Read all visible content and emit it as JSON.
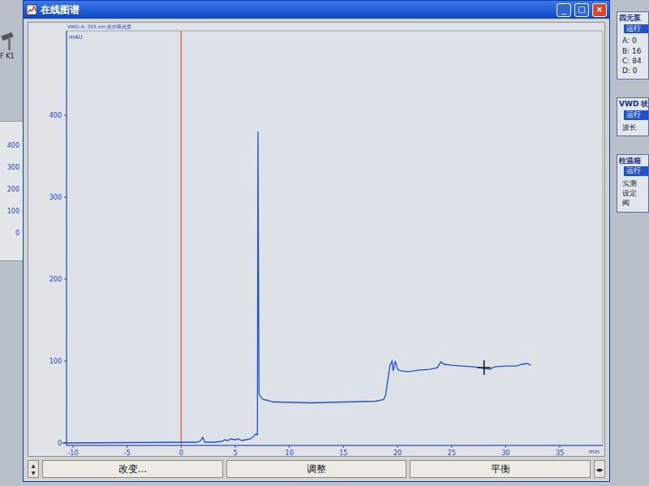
{
  "window": {
    "title": "在线图谱",
    "controls": [
      "_",
      "□",
      "×"
    ]
  },
  "left_panel": {
    "label": "F K1",
    "y_ticks": [
      "400",
      "300",
      "200",
      "100",
      "0"
    ]
  },
  "chart": {
    "title": "VWD A: 355 nm 处的吸光度",
    "y_unit": "mAU",
    "x_unit": "min",
    "y_ticks": [
      "0",
      "100",
      "200",
      "300",
      "400"
    ],
    "x_ticks": [
      "-10",
      "-5",
      "0",
      "5",
      "10",
      "15",
      "20",
      "25",
      "30",
      "35"
    ],
    "marker_x": 0,
    "cursor": {
      "x": 28,
      "y": 92
    },
    "series": [
      {
        "x": [
          -11,
          1.5,
          1.8,
          2,
          2.2,
          3,
          3.8,
          4,
          4.3,
          4.6,
          5,
          5.3,
          5.6,
          6,
          6.4,
          6.7,
          6.9,
          7.05,
          7.1,
          7.2,
          7.4,
          7.6,
          8,
          8.5,
          9,
          12,
          15,
          18,
          18.7,
          18.9,
          19.3,
          19.5,
          19.6,
          19.8,
          20,
          20.3,
          21,
          22,
          23,
          23.7,
          24,
          24.3,
          25,
          26,
          27,
          28,
          28.5,
          29,
          30,
          31,
          31.5,
          32,
          32.3
        ],
        "y": [
          0,
          1,
          3,
          7,
          1,
          1,
          2,
          4,
          3,
          5,
          4,
          5,
          3,
          4,
          5,
          8,
          11,
          10,
          380,
          60,
          55,
          53,
          52,
          50,
          50,
          49,
          50,
          51,
          53,
          58,
          95,
          100,
          88,
          100,
          90,
          88,
          87,
          89,
          90,
          92,
          99,
          96,
          95,
          94,
          93,
          91,
          90,
          93,
          94,
          94,
          96,
          97,
          95
        ]
      }
    ]
  },
  "spinner": {
    "up": "▲",
    "down": "▼"
  },
  "buttons": [
    {
      "label": "改变..."
    },
    {
      "label": "调整"
    },
    {
      "label": "平衡"
    }
  ],
  "pager": {
    "left": "◀",
    "right": "▶"
  },
  "status_panels": [
    {
      "title": "四元泵",
      "state": "运行",
      "lines": [
        "A: 0",
        "B: 16",
        "C: 84",
        "D: 0"
      ]
    },
    {
      "title": "VWD 状",
      "state": "运行",
      "lines": [
        "波长"
      ]
    },
    {
      "title": "柱温箱",
      "state": "运行",
      "lines": [
        "实测",
        "设定",
        "阀"
      ]
    }
  ]
}
